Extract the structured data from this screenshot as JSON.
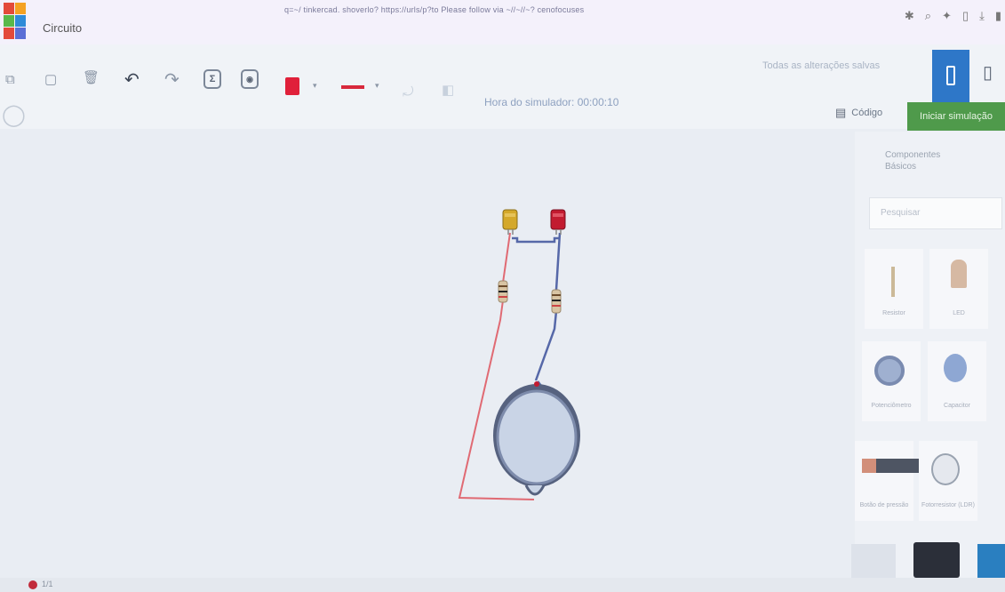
{
  "browser": {
    "url": "q=~/ tinkercad. shoverlo? https://urls/p?to Please follow via ~//~//~? cenofocuses",
    "tab_title": "Circuito",
    "icon_colors": [
      "#e34a3a",
      "#f4a223",
      "#59b84a",
      "#2e8bd8",
      "#e34a3a",
      "#5a6fd6"
    ]
  },
  "toolbar": {
    "simulator_time": "Hora do simulador: 00:00:10",
    "saved_status": "Todas as alterações salvas",
    "code_label": "Código",
    "start_simulation_label": "Iniciar simulação",
    "fill_color": "#e0203a",
    "wire_color": "#d8283c"
  },
  "panel": {
    "components_title": "Componentes",
    "components_subtitle": "Básicos",
    "search_placeholder": "Pesquisar",
    "items": [
      {
        "label": "Resistor"
      },
      {
        "label": "LED"
      },
      {
        "label": "Potenciômetro"
      },
      {
        "label": "Capacitor"
      },
      {
        "label": "Botão de pressão"
      },
      {
        "label": "Fotorresistor (LDR)"
      }
    ]
  },
  "statusbar": {
    "text": "1/1"
  },
  "circuit": {
    "led_left_color": "#d4a82a",
    "led_right_color": "#c21b30",
    "wire_red": "#e06a73",
    "wire_blue": "#5668a8"
  }
}
